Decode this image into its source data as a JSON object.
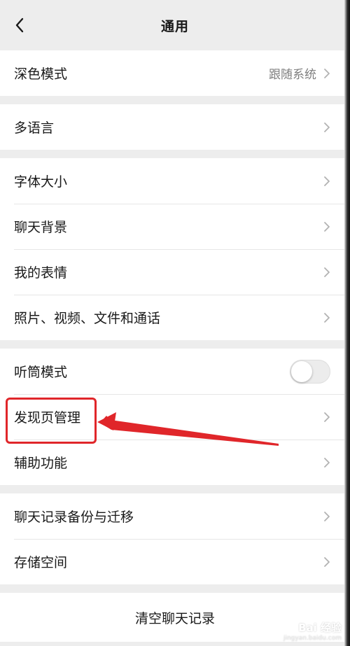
{
  "header": {
    "title": "通用",
    "back_icon": "chevron-left-icon"
  },
  "groups": [
    [
      {
        "id": "dark-mode",
        "label": "深色模式",
        "value": "跟随系统"
      }
    ],
    [
      {
        "id": "multi-language",
        "label": "多语言"
      }
    ],
    [
      {
        "id": "font-size",
        "label": "字体大小"
      },
      {
        "id": "chat-background",
        "label": "聊天背景"
      },
      {
        "id": "my-stickers",
        "label": "我的表情"
      },
      {
        "id": "media-files",
        "label": "照片、视频、文件和通话"
      }
    ],
    [
      {
        "id": "earpiece-mode",
        "label": "听筒模式",
        "toggle": false
      },
      {
        "id": "discover-management",
        "label": "发现页管理"
      },
      {
        "id": "accessibility",
        "label": "辅助功能"
      }
    ],
    [
      {
        "id": "chat-backup",
        "label": "聊天记录备份与迁移"
      },
      {
        "id": "storage",
        "label": "存储空间"
      }
    ]
  ],
  "footer": {
    "clear_label": "清空聊天记录"
  },
  "watermark": {
    "text": "Bai 经验",
    "sub": "jingyan.baidu.com"
  },
  "colors": {
    "background": "#ededed",
    "annotation": "#e0262a",
    "value_text": "#7f7f7f"
  }
}
